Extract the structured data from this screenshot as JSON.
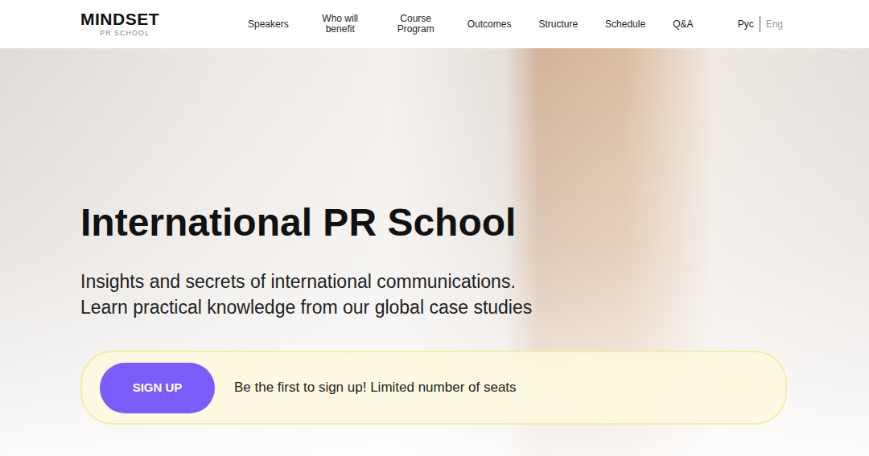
{
  "header": {
    "logo": {
      "title": "MINDSET",
      "subtitle": "PR SCHOOL"
    },
    "nav": [
      {
        "label": "Speakers"
      },
      {
        "label": "Who will benefit"
      },
      {
        "label": "Course Program"
      },
      {
        "label": "Outcomes"
      },
      {
        "label": "Structure"
      },
      {
        "label": "Schedule"
      },
      {
        "label": "Q&A"
      }
    ],
    "languages": [
      {
        "label": "Рус",
        "selected": true
      },
      {
        "label": "Eng",
        "selected": false
      }
    ]
  },
  "hero": {
    "title": "International PR School",
    "subtitle_lines": [
      "Insights and secrets of international communications.",
      "Learn practical knowledge from our global case studies"
    ],
    "cta": {
      "button": "SIGN UP",
      "note": "Be the first to sign up! Limited number of seats"
    }
  }
}
